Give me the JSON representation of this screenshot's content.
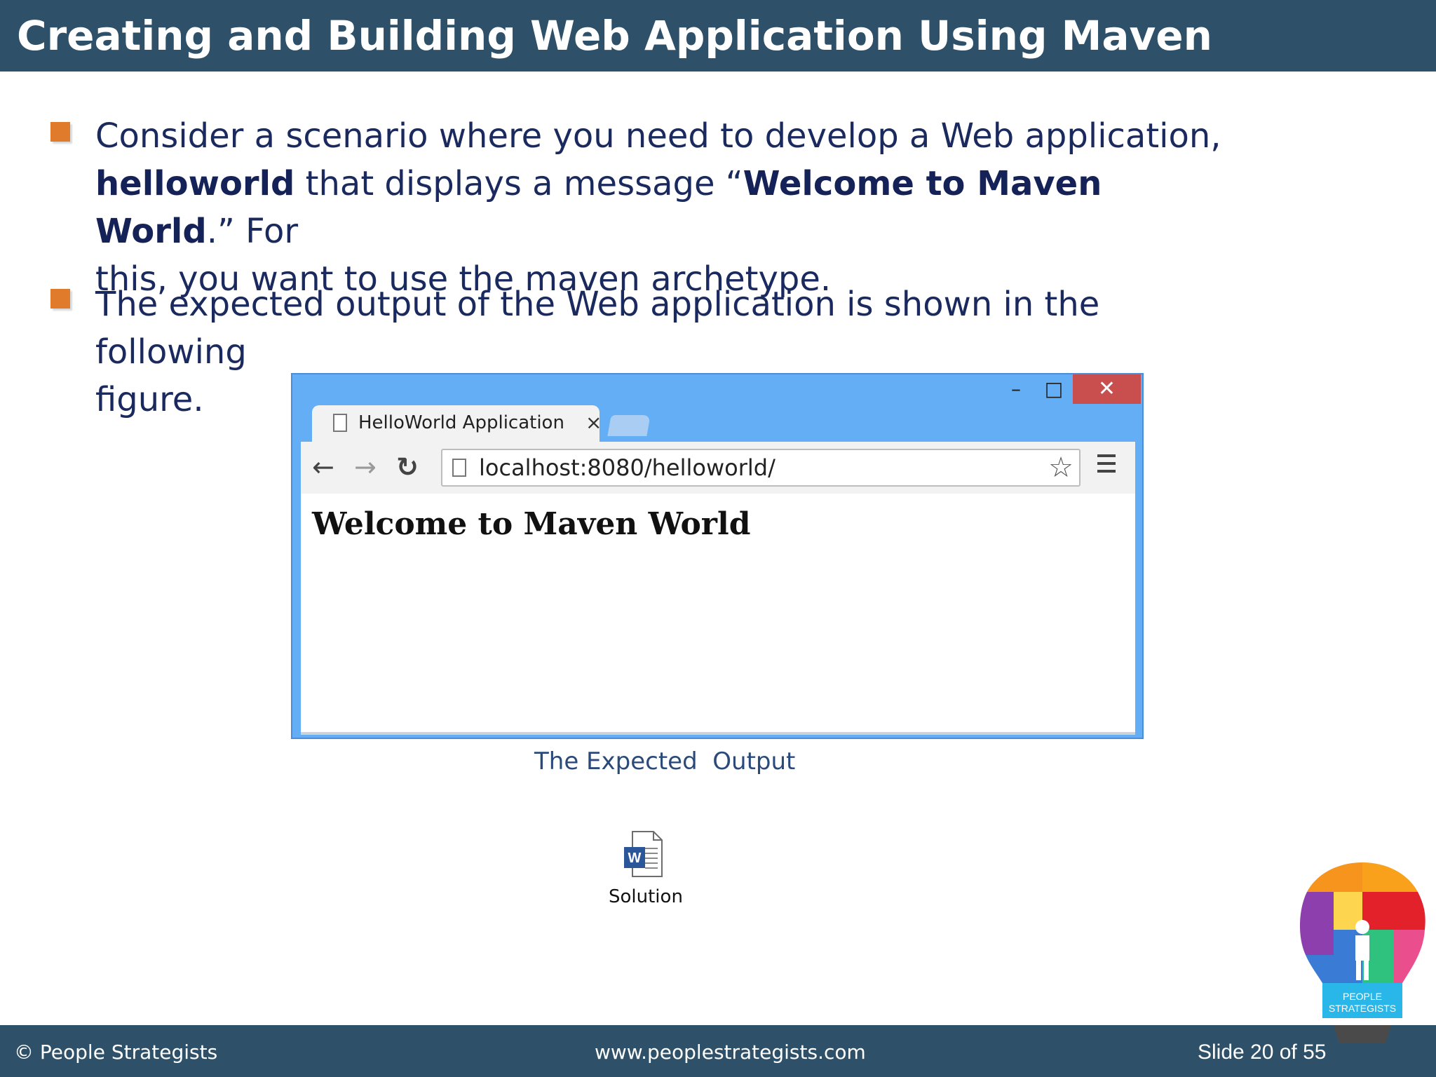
{
  "header": {
    "title": "Creating and Building Web Application Using Maven"
  },
  "bullets": [
    {
      "line1": "Consider a scenario where you need to develop a Web application,",
      "bold1": "helloworld",
      "text2": " that displays a message “",
      "bold2": "Welcome to Maven World",
      "text3": ".” For",
      "line3": "this, you want to use the maven archetype."
    },
    {
      "line1": "The expected output of the Web application is shown in the following",
      "line2": "figure."
    }
  ],
  "browser": {
    "window_controls": {
      "minimize": "–",
      "maximize": "□",
      "close": "✕"
    },
    "tab_title": "HelloWorld Application",
    "tab_close": "×",
    "nav": {
      "back": "←",
      "forward": "→",
      "reload": "↻"
    },
    "url": "localhost:8080/helloworld/",
    "star": "☆",
    "page_heading": "Welcome to Maven World"
  },
  "caption": "The Expected  Output",
  "attachment": {
    "label": "Solution",
    "icon": "word-document-icon",
    "icon_letter": "W"
  },
  "footer": {
    "copyright": "© People Strategists",
    "website": "www.peoplestrategists.com",
    "slide": "Slide 20 of 55"
  },
  "logo": {
    "text_line1": "PEOPLE",
    "text_line2": "STRATEGISTS"
  },
  "colors": {
    "header_bg": "#2e5068",
    "bullet": "#e07b2c",
    "text": "#1b2a5e",
    "browser_frame": "#64aef5",
    "close_button": "#c94f4f"
  }
}
